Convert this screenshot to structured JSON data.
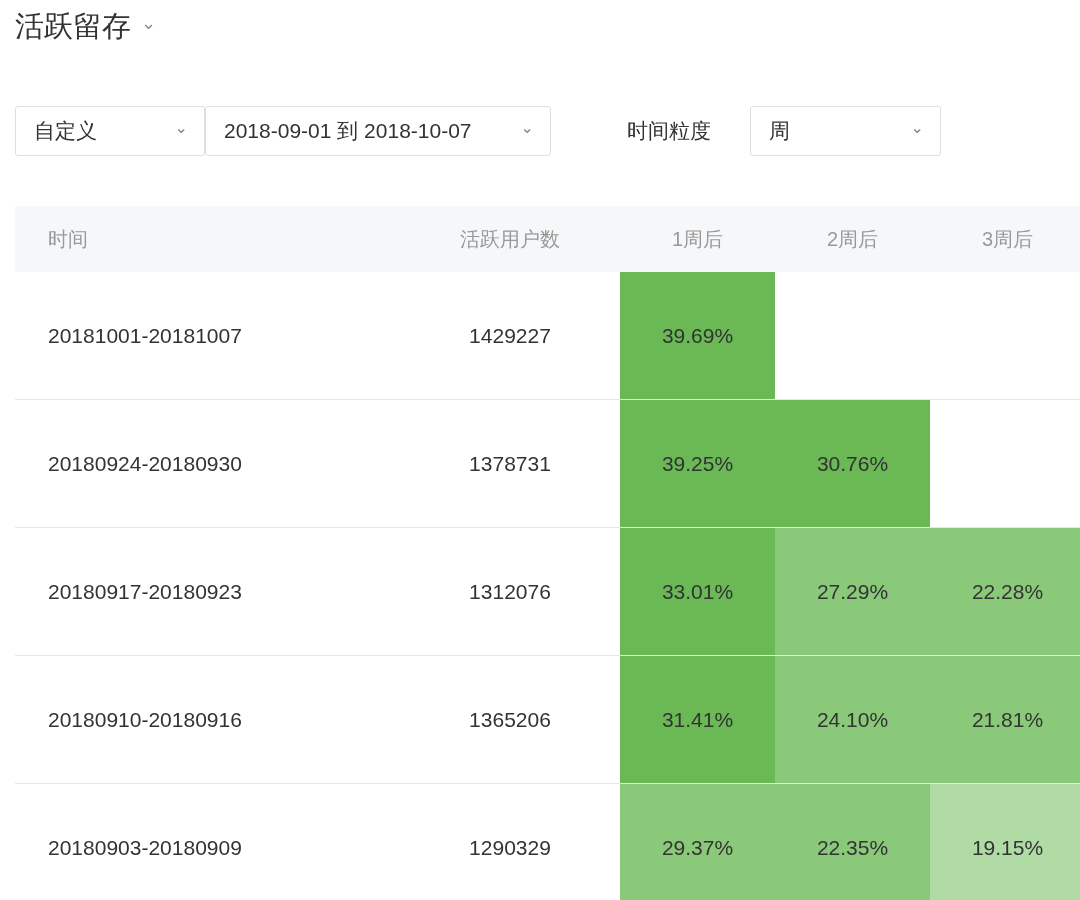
{
  "title": "活跃留存",
  "title_caret": "⌄",
  "filters": [
    {
      "value": "自定义",
      "caret": "⌄"
    },
    {
      "value": "2018-09-01 到 2018-10-07",
      "caret": "⌄"
    }
  ],
  "granularity": {
    "label": "时间粒度",
    "value": "周",
    "caret": "⌄"
  },
  "table": {
    "columns": [
      "时间",
      "活跃用户数",
      "1周后",
      "2周后",
      "3周后"
    ],
    "rows": [
      {
        "cells": [
          {
            "value": "20181001-20181007"
          },
          {
            "value": "1429227"
          },
          {
            "value": "39.69%",
            "color": "#6ab955"
          }
        ]
      },
      {
        "cells": [
          {
            "value": "20180924-20180930"
          },
          {
            "value": "1378731"
          },
          {
            "value": "39.25%",
            "color": "#6ab955"
          },
          {
            "value": "30.76%",
            "color": "#6ab955"
          }
        ]
      },
      {
        "cells": [
          {
            "value": "20180917-20180923"
          },
          {
            "value": "1312076"
          },
          {
            "value": "33.01%",
            "color": "#6ab955"
          },
          {
            "value": "27.29%",
            "color": "#8ac97a"
          },
          {
            "value": "22.28%",
            "color": "#8ac97a"
          }
        ]
      },
      {
        "cells": [
          {
            "value": "20180910-20180916"
          },
          {
            "value": "1365206"
          },
          {
            "value": "31.41%",
            "color": "#6ab955"
          },
          {
            "value": "24.10%",
            "color": "#8ac97a"
          },
          {
            "value": "21.81%",
            "color": "#8ac97a"
          }
        ]
      },
      {
        "cells": [
          {
            "value": "20180903-20180909"
          },
          {
            "value": "1290329"
          },
          {
            "value": "29.37%",
            "color": "#8ac97a"
          },
          {
            "value": "22.35%",
            "color": "#8ac97a"
          },
          {
            "value": "19.15%",
            "color": "#b0dba5"
          }
        ]
      }
    ]
  }
}
